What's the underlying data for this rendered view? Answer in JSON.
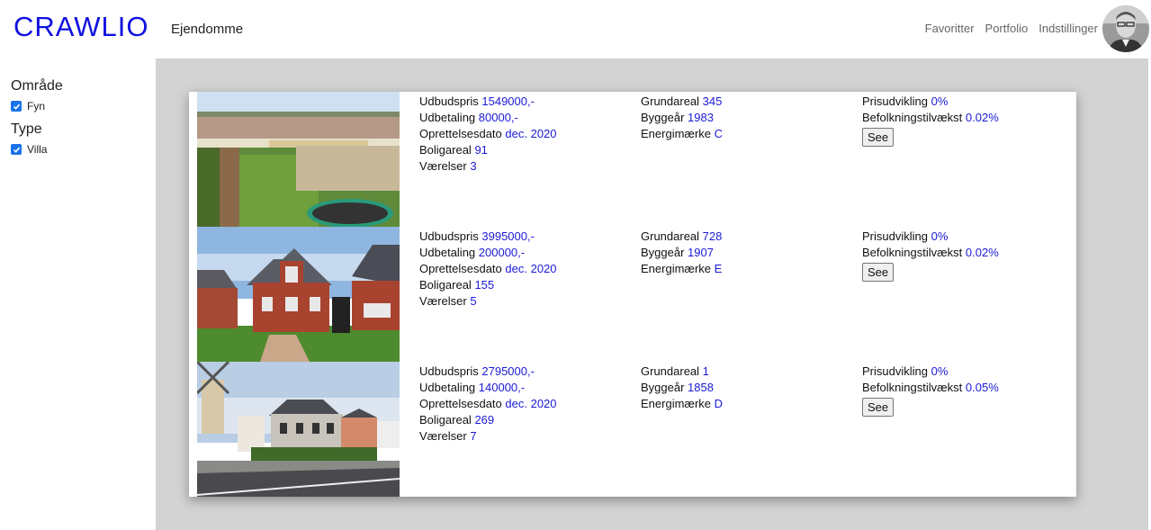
{
  "header": {
    "logo": "CRAWLIO",
    "section": "Ejendomme",
    "nav": [
      "Favoritter",
      "Portfolio",
      "Indstillinger"
    ]
  },
  "sidebar": {
    "area_heading": "Område",
    "area_option": "Fyn",
    "type_heading": "Type",
    "type_option": "Villa"
  },
  "labels": {
    "price": "Udbudspris",
    "down": "Udbetaling",
    "created": "Oprettelsesdato",
    "living": "Boligareal",
    "rooms": "Værelser",
    "ground": "Grundareal",
    "built": "Byggeår",
    "energy": "Energimærke",
    "price_dev": "Prisudvikling",
    "pop_growth": "Befolkningstilvækst",
    "see": "See"
  },
  "listings": [
    {
      "price": "1549000,-",
      "down": "80000,-",
      "created": "dec. 2020",
      "living": "91",
      "rooms": "3",
      "ground": "345",
      "built": "1983",
      "energy": "C",
      "price_dev": "0%",
      "pop_growth": "0.02%"
    },
    {
      "price": "3995000,-",
      "down": "200000,-",
      "created": "dec. 2020",
      "living": "155",
      "rooms": "5",
      "ground": "728",
      "built": "1907",
      "energy": "E",
      "price_dev": "0%",
      "pop_growth": "0.02%"
    },
    {
      "price": "2795000,-",
      "down": "140000,-",
      "created": "dec. 2020",
      "living": "269",
      "rooms": "7",
      "ground": "1",
      "built": "1858",
      "energy": "D",
      "price_dev": "0%",
      "pop_growth": "0.05%"
    }
  ],
  "colors": {
    "logo": "#1010e0",
    "value": "#1a1ad6",
    "main_bg": "#d3d3d3",
    "checkbox": "#1a73e8"
  }
}
